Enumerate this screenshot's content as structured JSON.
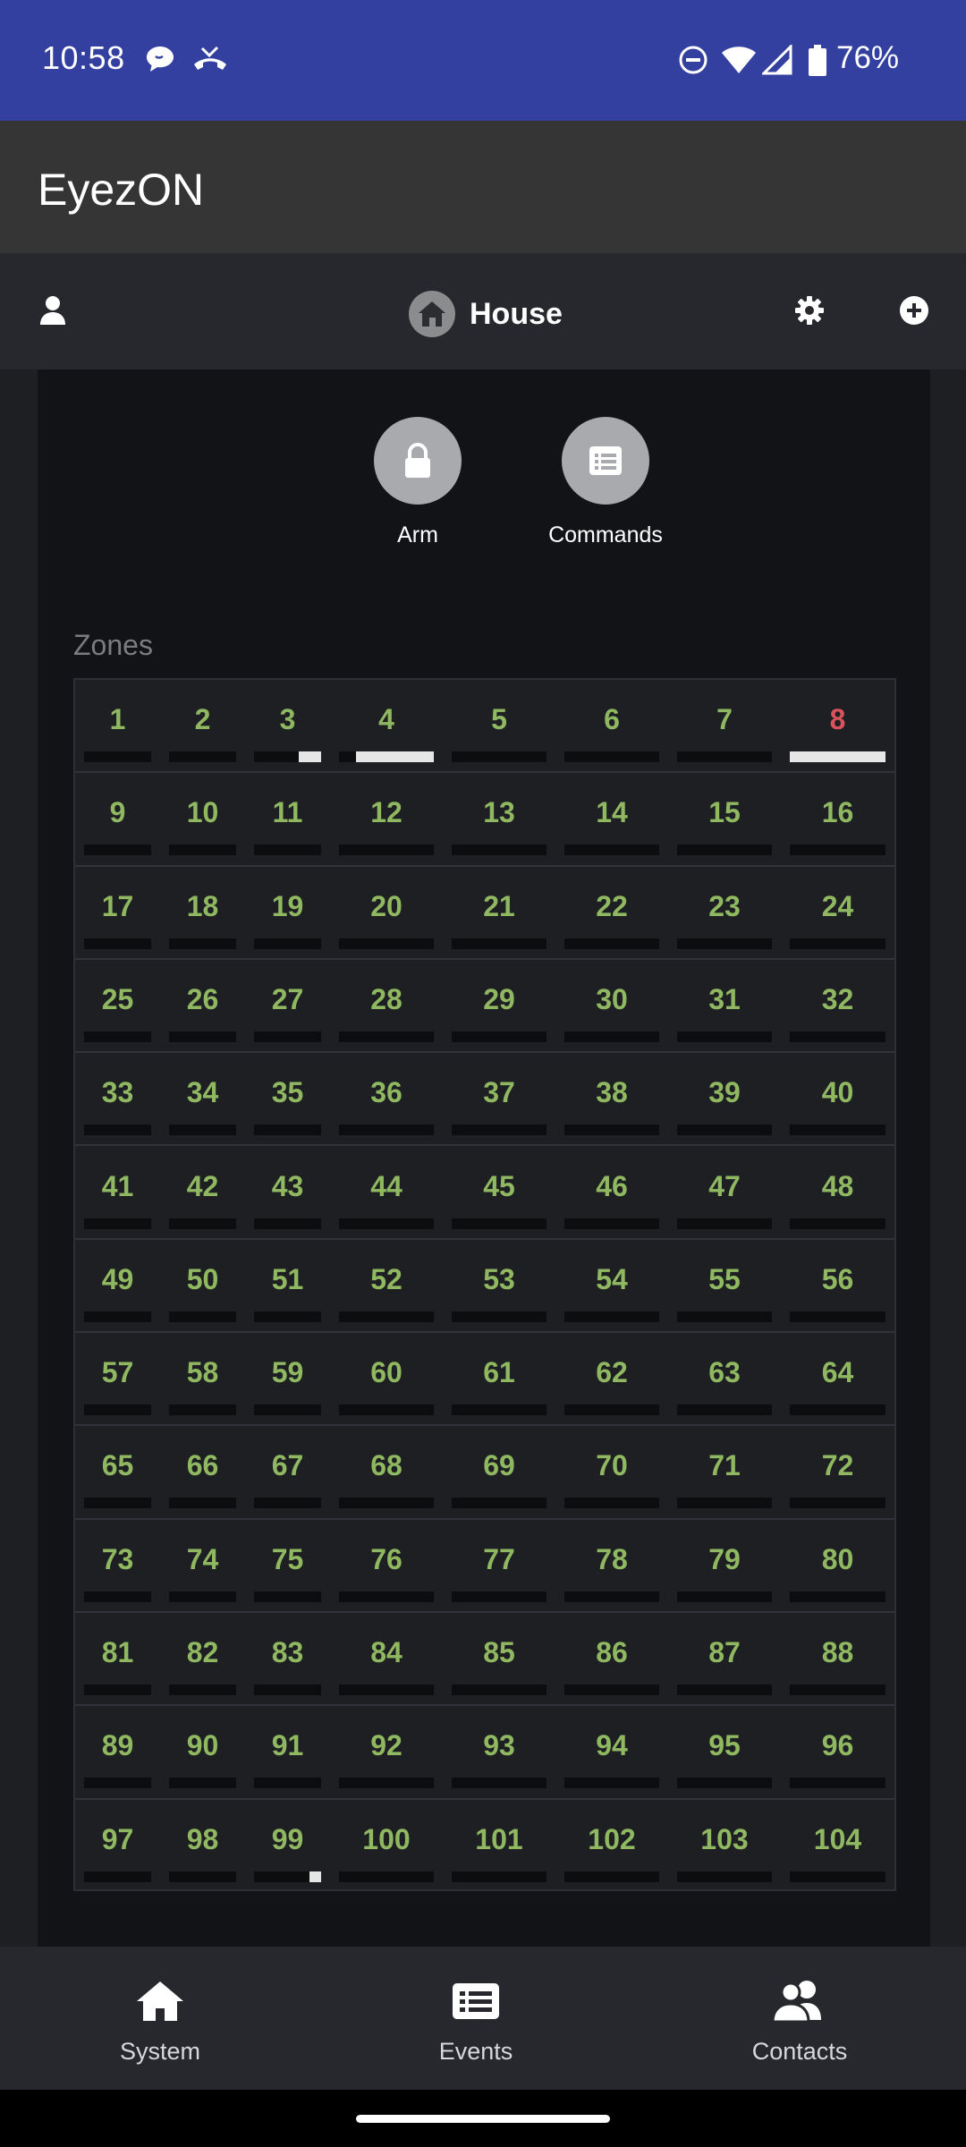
{
  "status": {
    "time": "10:58",
    "battery": "76%",
    "icons": [
      "chat-bubble-icon",
      "missed-call-icon",
      "do-not-disturb-icon",
      "wifi-icon",
      "signal-icon",
      "battery-icon"
    ]
  },
  "app": {
    "title": "EyezON"
  },
  "toolbar": {
    "location": "House",
    "icons": [
      "user-icon",
      "house-icon",
      "gear-icon",
      "add-circle-icon"
    ]
  },
  "actions": [
    {
      "label": "Arm",
      "icon": "lock-icon"
    },
    {
      "label": "Commands",
      "icon": "list-icon"
    }
  ],
  "zones": {
    "label": "Zones",
    "rows": [
      [
        "1",
        "2",
        "3",
        "4",
        "5",
        "6",
        "7",
        "8"
      ],
      [
        "9",
        "10",
        "11",
        "12",
        "13",
        "14",
        "15",
        "16"
      ],
      [
        "17",
        "18",
        "19",
        "20",
        "21",
        "22",
        "23",
        "24"
      ],
      [
        "25",
        "26",
        "27",
        "28",
        "29",
        "30",
        "31",
        "32"
      ],
      [
        "33",
        "34",
        "35",
        "36",
        "37",
        "38",
        "39",
        "40"
      ],
      [
        "41",
        "42",
        "43",
        "44",
        "45",
        "46",
        "47",
        "48"
      ],
      [
        "49",
        "50",
        "51",
        "52",
        "53",
        "54",
        "55",
        "56"
      ],
      [
        "57",
        "58",
        "59",
        "60",
        "61",
        "62",
        "63",
        "64"
      ],
      [
        "65",
        "66",
        "67",
        "68",
        "69",
        "70",
        "71",
        "72"
      ],
      [
        "73",
        "74",
        "75",
        "76",
        "77",
        "78",
        "79",
        "80"
      ],
      [
        "81",
        "82",
        "83",
        "84",
        "85",
        "86",
        "87",
        "88"
      ],
      [
        "89",
        "90",
        "91",
        "92",
        "93",
        "94",
        "95",
        "96"
      ],
      [
        "97",
        "98",
        "99",
        "100",
        "101",
        "102",
        "103",
        "104"
      ]
    ],
    "alarm_zones": [
      "8"
    ],
    "activity": {
      "3": 0.33,
      "4": 0.82,
      "8": 1.0,
      "99": 0.18
    },
    "colors": {
      "normal": "#8fb861",
      "alarm": "#d9525c"
    }
  },
  "nav": [
    {
      "label": "System",
      "icon": "house-icon"
    },
    {
      "label": "Events",
      "icon": "list-icon"
    },
    {
      "label": "Contacts",
      "icon": "contacts-icon"
    }
  ]
}
